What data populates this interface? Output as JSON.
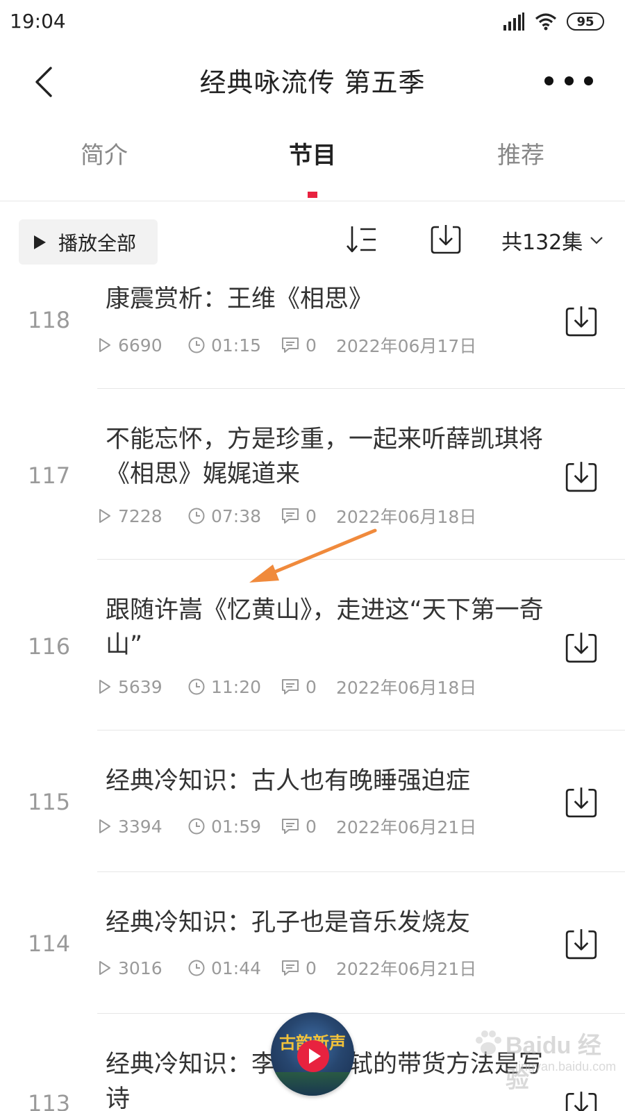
{
  "status_bar": {
    "time": "19:04",
    "battery": "95",
    "icons": [
      "signal-icon",
      "wifi-icon",
      "battery-icon"
    ]
  },
  "header": {
    "title": "经典咏流传 第五季",
    "back_icon": "chevron-left-icon",
    "more_icon": "more-dots-icon"
  },
  "tabs": [
    {
      "label": "简介",
      "active": false
    },
    {
      "label": "节目",
      "active": true
    },
    {
      "label": "推荐",
      "active": false
    }
  ],
  "toolbar": {
    "play_all_label": "播放全部",
    "episode_count": "共132集",
    "sort_icon": "sort-order-icon",
    "download_icon": "download-icon"
  },
  "episodes": [
    {
      "number": "118",
      "title": "康震赏析：王维《相思》",
      "plays": "6690",
      "duration": "01:15",
      "comments": "0",
      "date": "2022年06月17日"
    },
    {
      "number": "117",
      "title": "不能忘怀，方是珍重，一起来听薛凯琪将《相思》娓娓道来",
      "plays": "7228",
      "duration": "07:38",
      "comments": "0",
      "date": "2022年06月18日"
    },
    {
      "number": "116",
      "title": "跟随许嵩《忆黄山》，走进这“天下第一奇山”",
      "plays": "5639",
      "duration": "11:20",
      "comments": "0",
      "date": "2022年06月18日"
    },
    {
      "number": "115",
      "title": "经典冷知识：古人也有晚睡强迫症",
      "plays": "3394",
      "duration": "01:59",
      "comments": "0",
      "date": "2022年06月21日"
    },
    {
      "number": "114",
      "title": "经典冷知识：孔子也是音乐发烧友",
      "plays": "3016",
      "duration": "01:44",
      "comments": "0",
      "date": "2022年06月21日"
    },
    {
      "number": "113",
      "title": "经典冷知识：李白、苏轼的带货方法是写诗",
      "plays": "",
      "duration": "",
      "comments": "",
      "date": ""
    }
  ],
  "mini_player": {
    "cover_text": "古韵新声"
  },
  "watermark": {
    "brand": "Baidu 经验",
    "url": "jingyan.baidu.com"
  },
  "colors": {
    "accent": "#e8223f",
    "annotation_arrow": "#f08a3c",
    "text_primary": "#333333",
    "text_secondary": "#9a9a9a"
  }
}
